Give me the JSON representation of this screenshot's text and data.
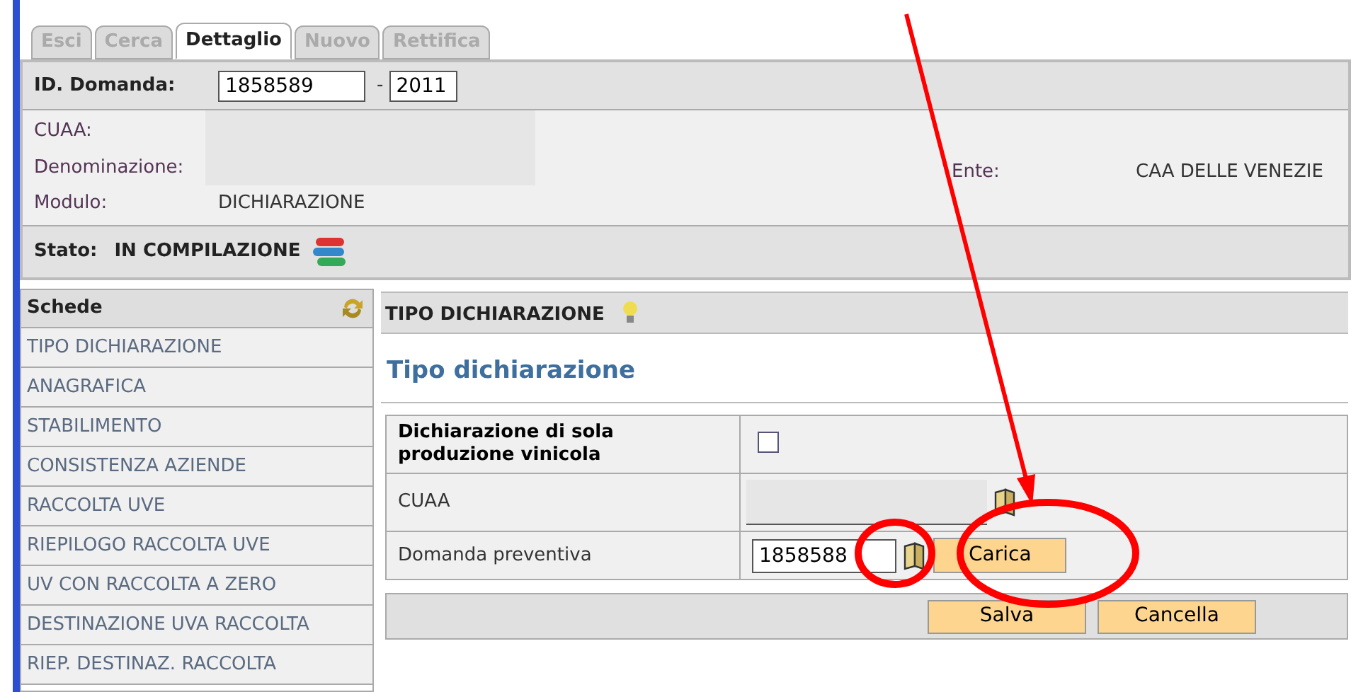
{
  "tabs": [
    {
      "label": "Esci",
      "selected": false
    },
    {
      "label": "Cerca",
      "selected": false
    },
    {
      "label": "Dettaglio",
      "selected": true
    },
    {
      "label": "Nuovo",
      "selected": false
    },
    {
      "label": "Rettifica",
      "selected": false
    }
  ],
  "header": {
    "id_label": "ID. Domanda:",
    "id_value": "1858589",
    "separator": "-",
    "year_value": "2011",
    "fields": [
      {
        "label": "CUAA:"
      },
      {
        "label": "Denominazione:"
      },
      {
        "label": "Modulo:",
        "value": "DICHIARAZIONE"
      }
    ],
    "ente_label": "Ente:",
    "ente_value": "CAA DELLE VENEZIE",
    "stato_label": "Stato:",
    "stato_value": "IN COMPILAZIONE"
  },
  "sidebar": {
    "title": "Schede",
    "items": [
      {
        "label": "TIPO DICHIARAZIONE"
      },
      {
        "label": "ANAGRAFICA"
      },
      {
        "label": "STABILIMENTO"
      },
      {
        "label": "CONSISTENZA AZIENDE"
      },
      {
        "label": "RACCOLTA UVE"
      },
      {
        "label": "RIEPILOGO RACCOLTA UVE"
      },
      {
        "label": "UV CON RACCOLTA A ZERO"
      },
      {
        "label": "DESTINAZIONE UVA RACCOLTA"
      },
      {
        "label": "RIEP. DESTINAZ. RACCOLTA"
      }
    ]
  },
  "main": {
    "section_title": "TIPO DICHIARAZIONE",
    "heading": "Tipo dichiarazione",
    "rows": [
      {
        "kind": "checkbox",
        "label": "Dichiarazione di sola produzione vinicola",
        "checked": false
      },
      {
        "kind": "lookup",
        "label": "CUAA"
      },
      {
        "kind": "load",
        "label": "Domanda preventiva",
        "value": "1858588",
        "button": "Carica"
      }
    ],
    "buttons": [
      "Salva",
      "Cancella"
    ]
  }
}
